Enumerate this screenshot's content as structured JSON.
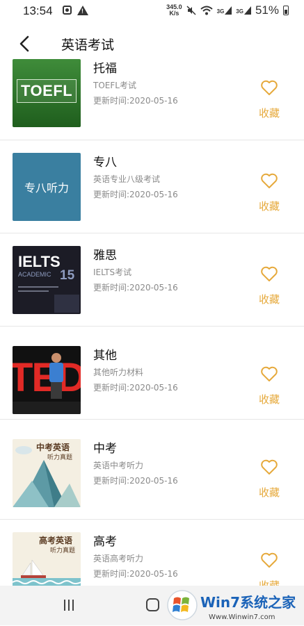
{
  "status": {
    "time": "13:54",
    "net_speed_value": "345.0",
    "net_speed_unit": "K/s",
    "sig1": "3G",
    "sig2": "3G",
    "battery": "51%"
  },
  "header": {
    "title": "英语考试"
  },
  "items": [
    {
      "title": "托福",
      "subtitle": "TOEFL考试",
      "date": "更新时间:2020-05-16",
      "thumb_text": "TOEFL",
      "fav_label": "收藏"
    },
    {
      "title": "专八",
      "subtitle": "英语专业八级考试",
      "date": "更新时间:2020-05-16",
      "thumb_text": "专八听力",
      "fav_label": "收藏"
    },
    {
      "title": "雅思",
      "subtitle": "IELTS考试",
      "date": "更新时间:2020-05-16",
      "thumb_text": "IELTS",
      "thumb_text2": "ACADEMIC",
      "thumb_text3": "15",
      "fav_label": "收藏"
    },
    {
      "title": "其他",
      "subtitle": "其他听力材料",
      "date": "更新时间:2020-05-16",
      "thumb_text": "TED",
      "fav_label": "收藏"
    },
    {
      "title": "中考",
      "subtitle": "英语中考听力",
      "date": "更新时间:2020-05-16",
      "thumb_text": "中考英语",
      "thumb_text2": "听力真题",
      "fav_label": "收藏"
    },
    {
      "title": "高考",
      "subtitle": "英语高考听力",
      "date": "更新时间:2020-05-16",
      "thumb_text": "高考英语",
      "thumb_text2": "听力真题",
      "fav_label": "收藏"
    }
  ],
  "watermark": {
    "brand": "Win7系统之家",
    "url": "Www.Winwin7.com"
  },
  "colors": {
    "accent": "#e6a93b",
    "divider": "#e6e6e6",
    "nav_bg": "#f3f3f3"
  },
  "icons": {
    "back": "chevron-left-icon",
    "favorite": "heart-outline-icon",
    "nav_recent": "recent-apps-icon",
    "nav_home": "home-icon"
  }
}
